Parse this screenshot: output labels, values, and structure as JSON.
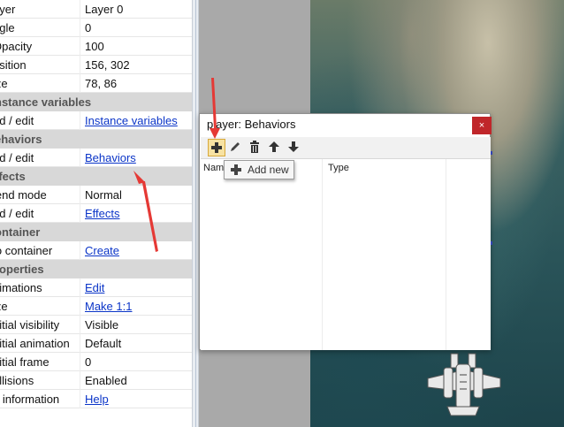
{
  "properties": {
    "rows": [
      {
        "key": "ayer",
        "value": "Layer 0",
        "link": false
      },
      {
        "key": "ngle",
        "value": "0",
        "link": false
      },
      {
        "key": "Opacity",
        "value": "100",
        "link": false
      },
      {
        "key": "osition",
        "value": "156, 302",
        "link": false
      },
      {
        "key": "ize",
        "value": "78, 86",
        "link": false
      }
    ],
    "instance_header": "nstance variables",
    "instance_row": {
      "key": "dd / edit",
      "value": "Instance variables"
    },
    "behaviors_header": "ehaviors",
    "behaviors_row": {
      "key": "dd / edit",
      "value": "Behaviors"
    },
    "effects_header": "ffects",
    "effects_rows": [
      {
        "key": "lend mode",
        "value": "Normal"
      },
      {
        "key": "dd / edit",
        "value": "Effects"
      }
    ],
    "container_header": "ontainer",
    "container_row": {
      "key": "lo container",
      "value": "Create"
    },
    "properties_header": "roperties",
    "properties_rows": [
      {
        "key": "nimations",
        "value": "Edit",
        "link": true
      },
      {
        "key": "ize",
        "value": "Make 1:1",
        "link": true
      },
      {
        "key": "nitial visibility",
        "value": "Visible",
        "link": false
      },
      {
        "key": "nitial animation",
        "value": "Default",
        "link": false
      },
      {
        "key": "nitial frame",
        "value": "0",
        "link": false
      },
      {
        "key": "ollisions",
        "value": "Enabled",
        "link": false
      },
      {
        "key": "e information",
        "value": "Help",
        "link": true
      }
    ]
  },
  "dialog": {
    "title": "player: Behaviors",
    "close_label": "×",
    "columns": {
      "name": "Nam",
      "type": "Type"
    },
    "tooltip": "Add new"
  },
  "colors": {
    "link": "#0b35c8",
    "header_bg": "#d8d8d8",
    "close_bg": "#c0262a",
    "arrow": "#e53935",
    "active_button_bg": "#f7e2a2"
  },
  "icons": [
    "add-icon",
    "edit-icon",
    "delete-icon",
    "move-up-icon",
    "move-down-icon"
  ]
}
